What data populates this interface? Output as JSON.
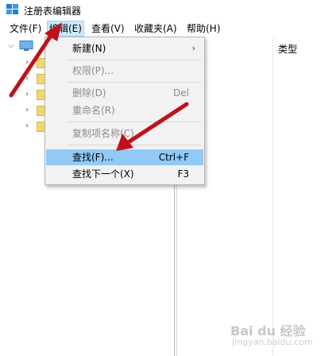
{
  "window": {
    "title": "注册表编辑器"
  },
  "menubar": {
    "file": "文件(F)",
    "edit": "编辑(E)",
    "view": "查看(V)",
    "favorites": "收藏夹(A)",
    "help": "帮助(H)"
  },
  "list_header": {
    "type_col": "类型"
  },
  "context_menu": {
    "new": {
      "label": "新建(N)"
    },
    "permissions": {
      "label": "权限(P)..."
    },
    "delete": {
      "label": "删除(D)",
      "shortcut": "Del"
    },
    "rename": {
      "label": "重命名(R)"
    },
    "copy_key_name": {
      "label": "复制项名称(C)"
    },
    "find": {
      "label": "查找(F)...",
      "shortcut": "Ctrl+F"
    },
    "find_next": {
      "label": "查找下一个(X)",
      "shortcut": "F3"
    }
  },
  "watermark": {
    "text": "Bai du 经验",
    "sub": "jingyan.baidu.com"
  },
  "colors": {
    "menu_active_bg": "#cce8ff",
    "menu_highlight": "#91c9f7",
    "annotation_arrow": "#c0101a",
    "disabled_text": "#8c8c8c"
  },
  "icons": [
    "registry-editor-icon",
    "computer-icon",
    "folder-icon",
    "chevron-right-icon",
    "chevron-down-icon"
  ]
}
